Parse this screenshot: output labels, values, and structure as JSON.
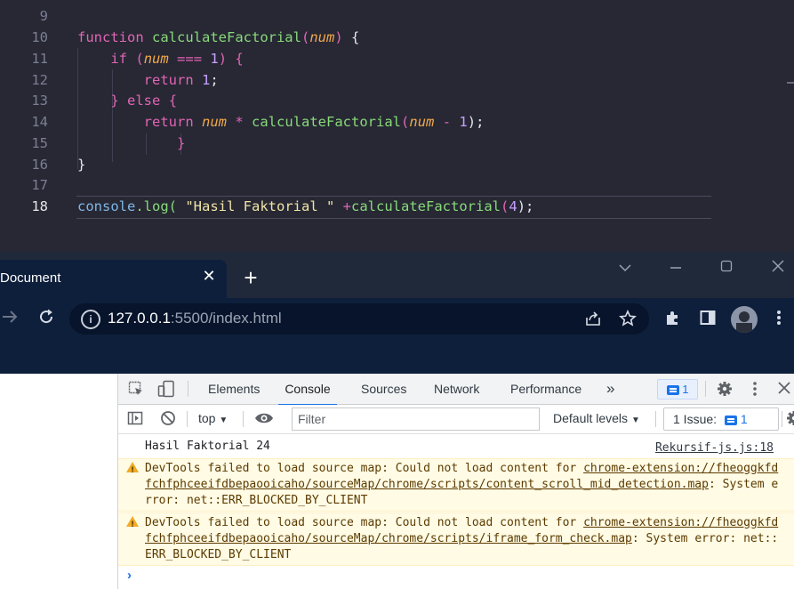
{
  "editor": {
    "lines": [
      {
        "num": "9"
      },
      {
        "num": "10"
      },
      {
        "num": "11"
      },
      {
        "num": "12"
      },
      {
        "num": "13"
      },
      {
        "num": "14"
      },
      {
        "num": "15"
      },
      {
        "num": "16"
      },
      {
        "num": "17"
      },
      {
        "num": "18"
      }
    ],
    "code": {
      "l10": [
        "function",
        "calculateFactorial",
        "(",
        "num",
        ")",
        " {"
      ],
      "l11": [
        "if",
        "(",
        "num",
        "===",
        "1",
        ")",
        "{"
      ],
      "l12": [
        "return",
        "1",
        ";"
      ],
      "l13": [
        "}",
        "else",
        "{"
      ],
      "l14": [
        "return",
        "num",
        "*",
        "calculateFactorial",
        "(",
        "num",
        "-",
        "1",
        ");"
      ],
      "l15": [
        "}"
      ],
      "l16": [
        "}"
      ],
      "l18": [
        "console",
        ".log(",
        "\"Hasil Faktorial \"",
        "+",
        "calculateFactorial",
        "(",
        "4",
        ");"
      ]
    }
  },
  "browser": {
    "tab_title": "Document",
    "tab_close": "✕",
    "new_tab": "+",
    "url_host": "127.0.0.1",
    "url_rest": ":5500/index.html"
  },
  "devtools": {
    "tabs": [
      "Elements",
      "Console",
      "Sources",
      "Network",
      "Performance"
    ],
    "active_tab": "Console",
    "more_tabs": "»",
    "messages_badge": "1",
    "context": "top",
    "filter_placeholder": "Filter",
    "levels": "Default levels",
    "issues_label": "1 Issue:",
    "issues_count": "1",
    "console_rows": [
      {
        "type": "log",
        "text": "Hasil Faktorial 24",
        "source": "Rekursif-js.js:18"
      },
      {
        "type": "warning",
        "prefix": "DevTools failed to load source map: Could not load content for ",
        "link": "chrome-extension://fheoggkfdfchfphceeifdbepaooicaho/sourceMap/chrome/scripts/content_scroll_mid_detection.map",
        "suffix": ": System error: net::ERR_BLOCKED_BY_CLIENT"
      },
      {
        "type": "warning",
        "prefix": "DevTools failed to load source map: Could not load content for ",
        "link": "chrome-extension://fheoggkfdfchfphceeifdbepaooicaho/sourceMap/chrome/scripts/iframe_form_check.map",
        "suffix": ": System error: net::ERR_BLOCKED_BY_CLIENT"
      }
    ],
    "prompt": "›"
  },
  "colors": {
    "editor_bg": "#272834",
    "keyword": "#e065b5",
    "function": "#89d97a",
    "param": "#f3a94a",
    "number": "#c7a0ff",
    "browser_frame": "#0e1f3b",
    "devtools_accent": "#1a73e8",
    "warning_bg": "#fffbe5"
  }
}
